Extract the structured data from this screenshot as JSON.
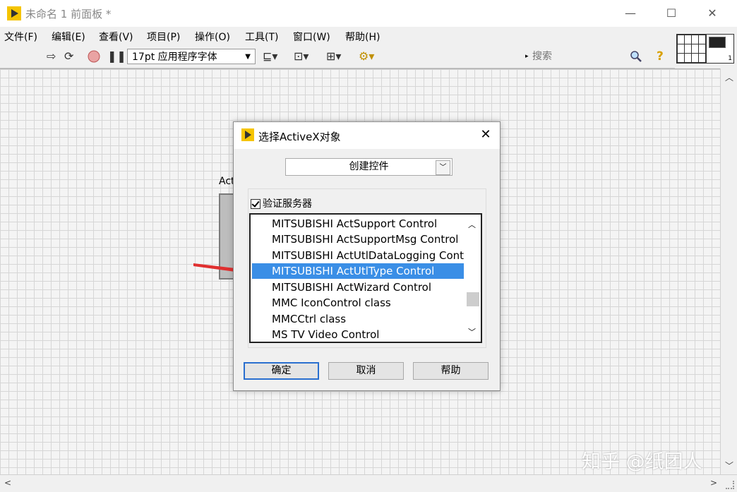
{
  "window": {
    "title": "未命名 1 前面板 *",
    "controls": {
      "minimize": "—",
      "maximize": "☐",
      "close": "✕"
    }
  },
  "menu": [
    "文件(F)",
    "编辑(E)",
    "查看(V)",
    "项目(P)",
    "操作(O)",
    "工具(T)",
    "窗口(W)",
    "帮助(H)"
  ],
  "toolbar": {
    "icons": [
      "run-arrow-icon",
      "run-continuously-icon",
      "abort-icon",
      "pause-icon"
    ],
    "font": "17pt 应用程序字体",
    "align_icons": [
      "align-objects-icon",
      "distribute-objects-icon",
      "resize-objects-icon",
      "reorder-icon"
    ],
    "search_placeholder": "搜索",
    "help_glyph": "?"
  },
  "connector": {
    "icon_number": "1"
  },
  "canvas": {
    "activex_label": "Act"
  },
  "dialog": {
    "title": "选择ActiveX对象",
    "close": "✕",
    "mode": "创建控件",
    "verify_label": "验证服务器",
    "verify_checked": true,
    "items": [
      "MITSUBISHI ActSupport Control",
      "MITSUBISHI ActSupportMsg Control",
      "MITSUBISHI ActUtlDataLogging Contr",
      "MITSUBISHI ActUtlType Control",
      "MITSUBISHI ActWizard Control",
      "MMC IconControl class",
      "MMCCtrl class",
      "MS TV Video Control"
    ],
    "selected_index": 3,
    "buttons": {
      "ok": "确定",
      "cancel": "取消",
      "help": "帮助"
    }
  },
  "annotation_color": "#e03030",
  "selection_color": "#3a8ee6",
  "watermark": "知乎 @纸团人"
}
